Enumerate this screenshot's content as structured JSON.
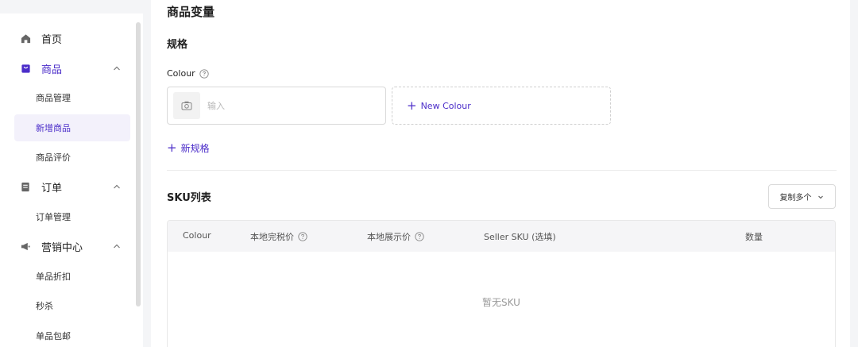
{
  "sidebar": {
    "nav": [
      {
        "label": "首页",
        "icon": "home-icon"
      },
      {
        "label": "商品",
        "icon": "shopping-bag-icon",
        "active": true,
        "expanded": true,
        "children": [
          {
            "label": "商品管理"
          },
          {
            "label": "新增商品",
            "active": true
          },
          {
            "label": "商品评价"
          }
        ]
      },
      {
        "label": "订单",
        "icon": "order-icon",
        "expanded": true,
        "children": [
          {
            "label": "订单管理"
          }
        ]
      },
      {
        "label": "营销中心",
        "icon": "megaphone-icon",
        "expanded": true,
        "children": [
          {
            "label": "单品折扣"
          },
          {
            "label": "秒杀"
          },
          {
            "label": "单品包邮"
          }
        ]
      }
    ]
  },
  "main": {
    "section_title": "商品变量",
    "spec_title": "规格",
    "colour_label": "Colour",
    "colour_input": {
      "placeholder": "输入",
      "value": ""
    },
    "new_colour_label": "New Colour",
    "new_spec_label": "新规格",
    "sku_title": "SKU列表",
    "copy_button_label": "复制多个",
    "table": {
      "columns": [
        {
          "label": "Colour",
          "help": false
        },
        {
          "label": "本地完税价",
          "help": true
        },
        {
          "label": "本地展示价",
          "help": true
        },
        {
          "label": "Seller SKU (选填)",
          "help": false
        },
        {
          "label": "数量",
          "help": false
        }
      ],
      "empty_text": "暂无SKU"
    }
  },
  "colors": {
    "accent": "#4b2dc9",
    "background": "#f4f5f7",
    "panel": "#ffffff"
  }
}
